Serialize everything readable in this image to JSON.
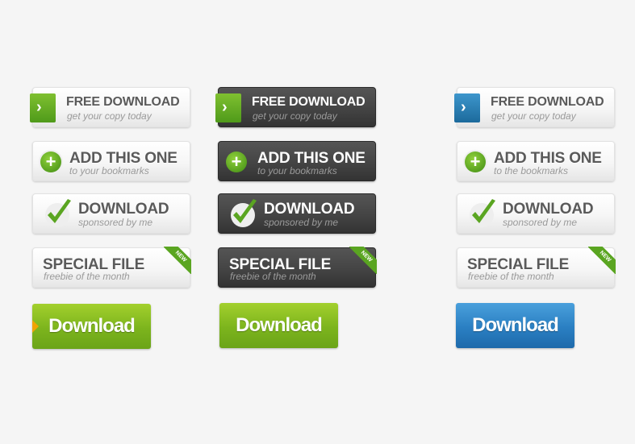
{
  "free_download": {
    "title": "FREE DOWNLOAD",
    "subtitle": "get your copy today",
    "icon": "chevron-right-icon"
  },
  "add_this_one": {
    "title": "ADD THIS ONE",
    "subtitle_a": "to your bookmarks",
    "subtitle_b": "to the bookmarks",
    "icon": "plus-icon"
  },
  "download": {
    "title": "DOWNLOAD",
    "subtitle": "sponsored by me",
    "icon": "checkmark-icon"
  },
  "special_file": {
    "title": "SPECIAL FILE",
    "subtitle": "freebie of the month",
    "badge": "NEW"
  },
  "download_big": {
    "label": "Download"
  },
  "colors": {
    "green": "#7cb41d",
    "blue": "#2a7fc2",
    "dark": "#444444",
    "light": "#f6f6f6"
  }
}
